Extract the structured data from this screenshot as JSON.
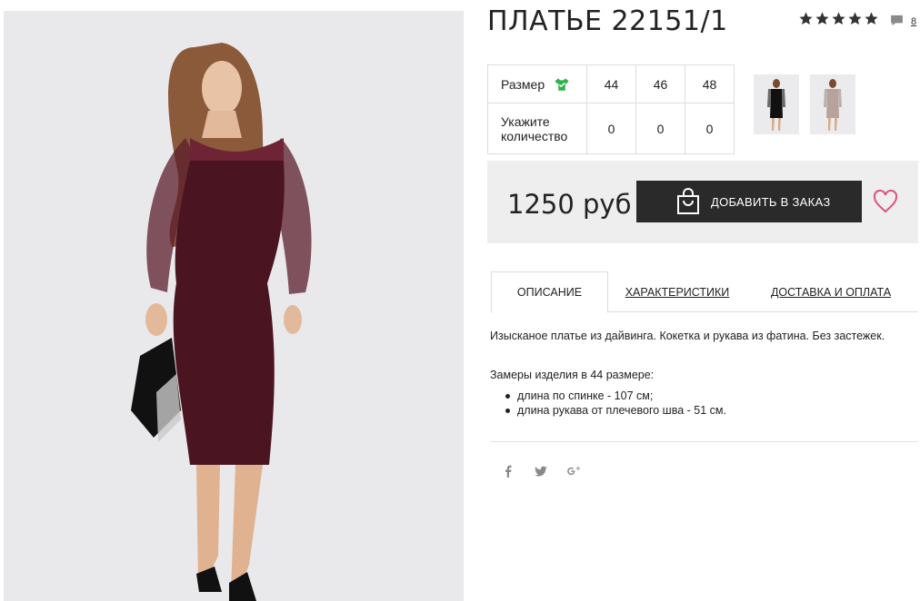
{
  "product": {
    "title": "ПЛАТЬЕ 22151/1",
    "rating_stars": 5,
    "comments_count": "8",
    "image_icon": "product-photo"
  },
  "sizes": {
    "size_label": "Размер",
    "qty_label_line1": "Укажите",
    "qty_label_line2": "количество",
    "columns": [
      "44",
      "46",
      "48"
    ],
    "quantities": [
      "0",
      "0",
      "0"
    ]
  },
  "thumbnails": [
    "thumbnail-black-dress",
    "thumbnail-beige-dress"
  ],
  "purchase": {
    "price": "1250 руб",
    "add_button": "ДОБАВИТЬ В ЗАКАЗ",
    "accent_color": "#d9557c",
    "button_color": "#2a2a2a"
  },
  "tabs": [
    {
      "label": "ОПИСАНИЕ",
      "active": true
    },
    {
      "label": "ХАРАКТЕРИСТИКИ",
      "active": false
    },
    {
      "label": "ДОСТАВКА И ОПЛАТА",
      "active": false
    }
  ],
  "description": {
    "text": "Изысканое платье из дайвинга. Кокетка и рукава из фатина. Без застежек.",
    "measurements_title": "Замеры изделия в 44 размере:",
    "measurements": [
      "длина по спинке - 107 см;",
      "длина рукава от плечевого шва - 51 см."
    ]
  },
  "social": [
    "facebook-icon",
    "twitter-icon",
    "google-plus-icon"
  ]
}
